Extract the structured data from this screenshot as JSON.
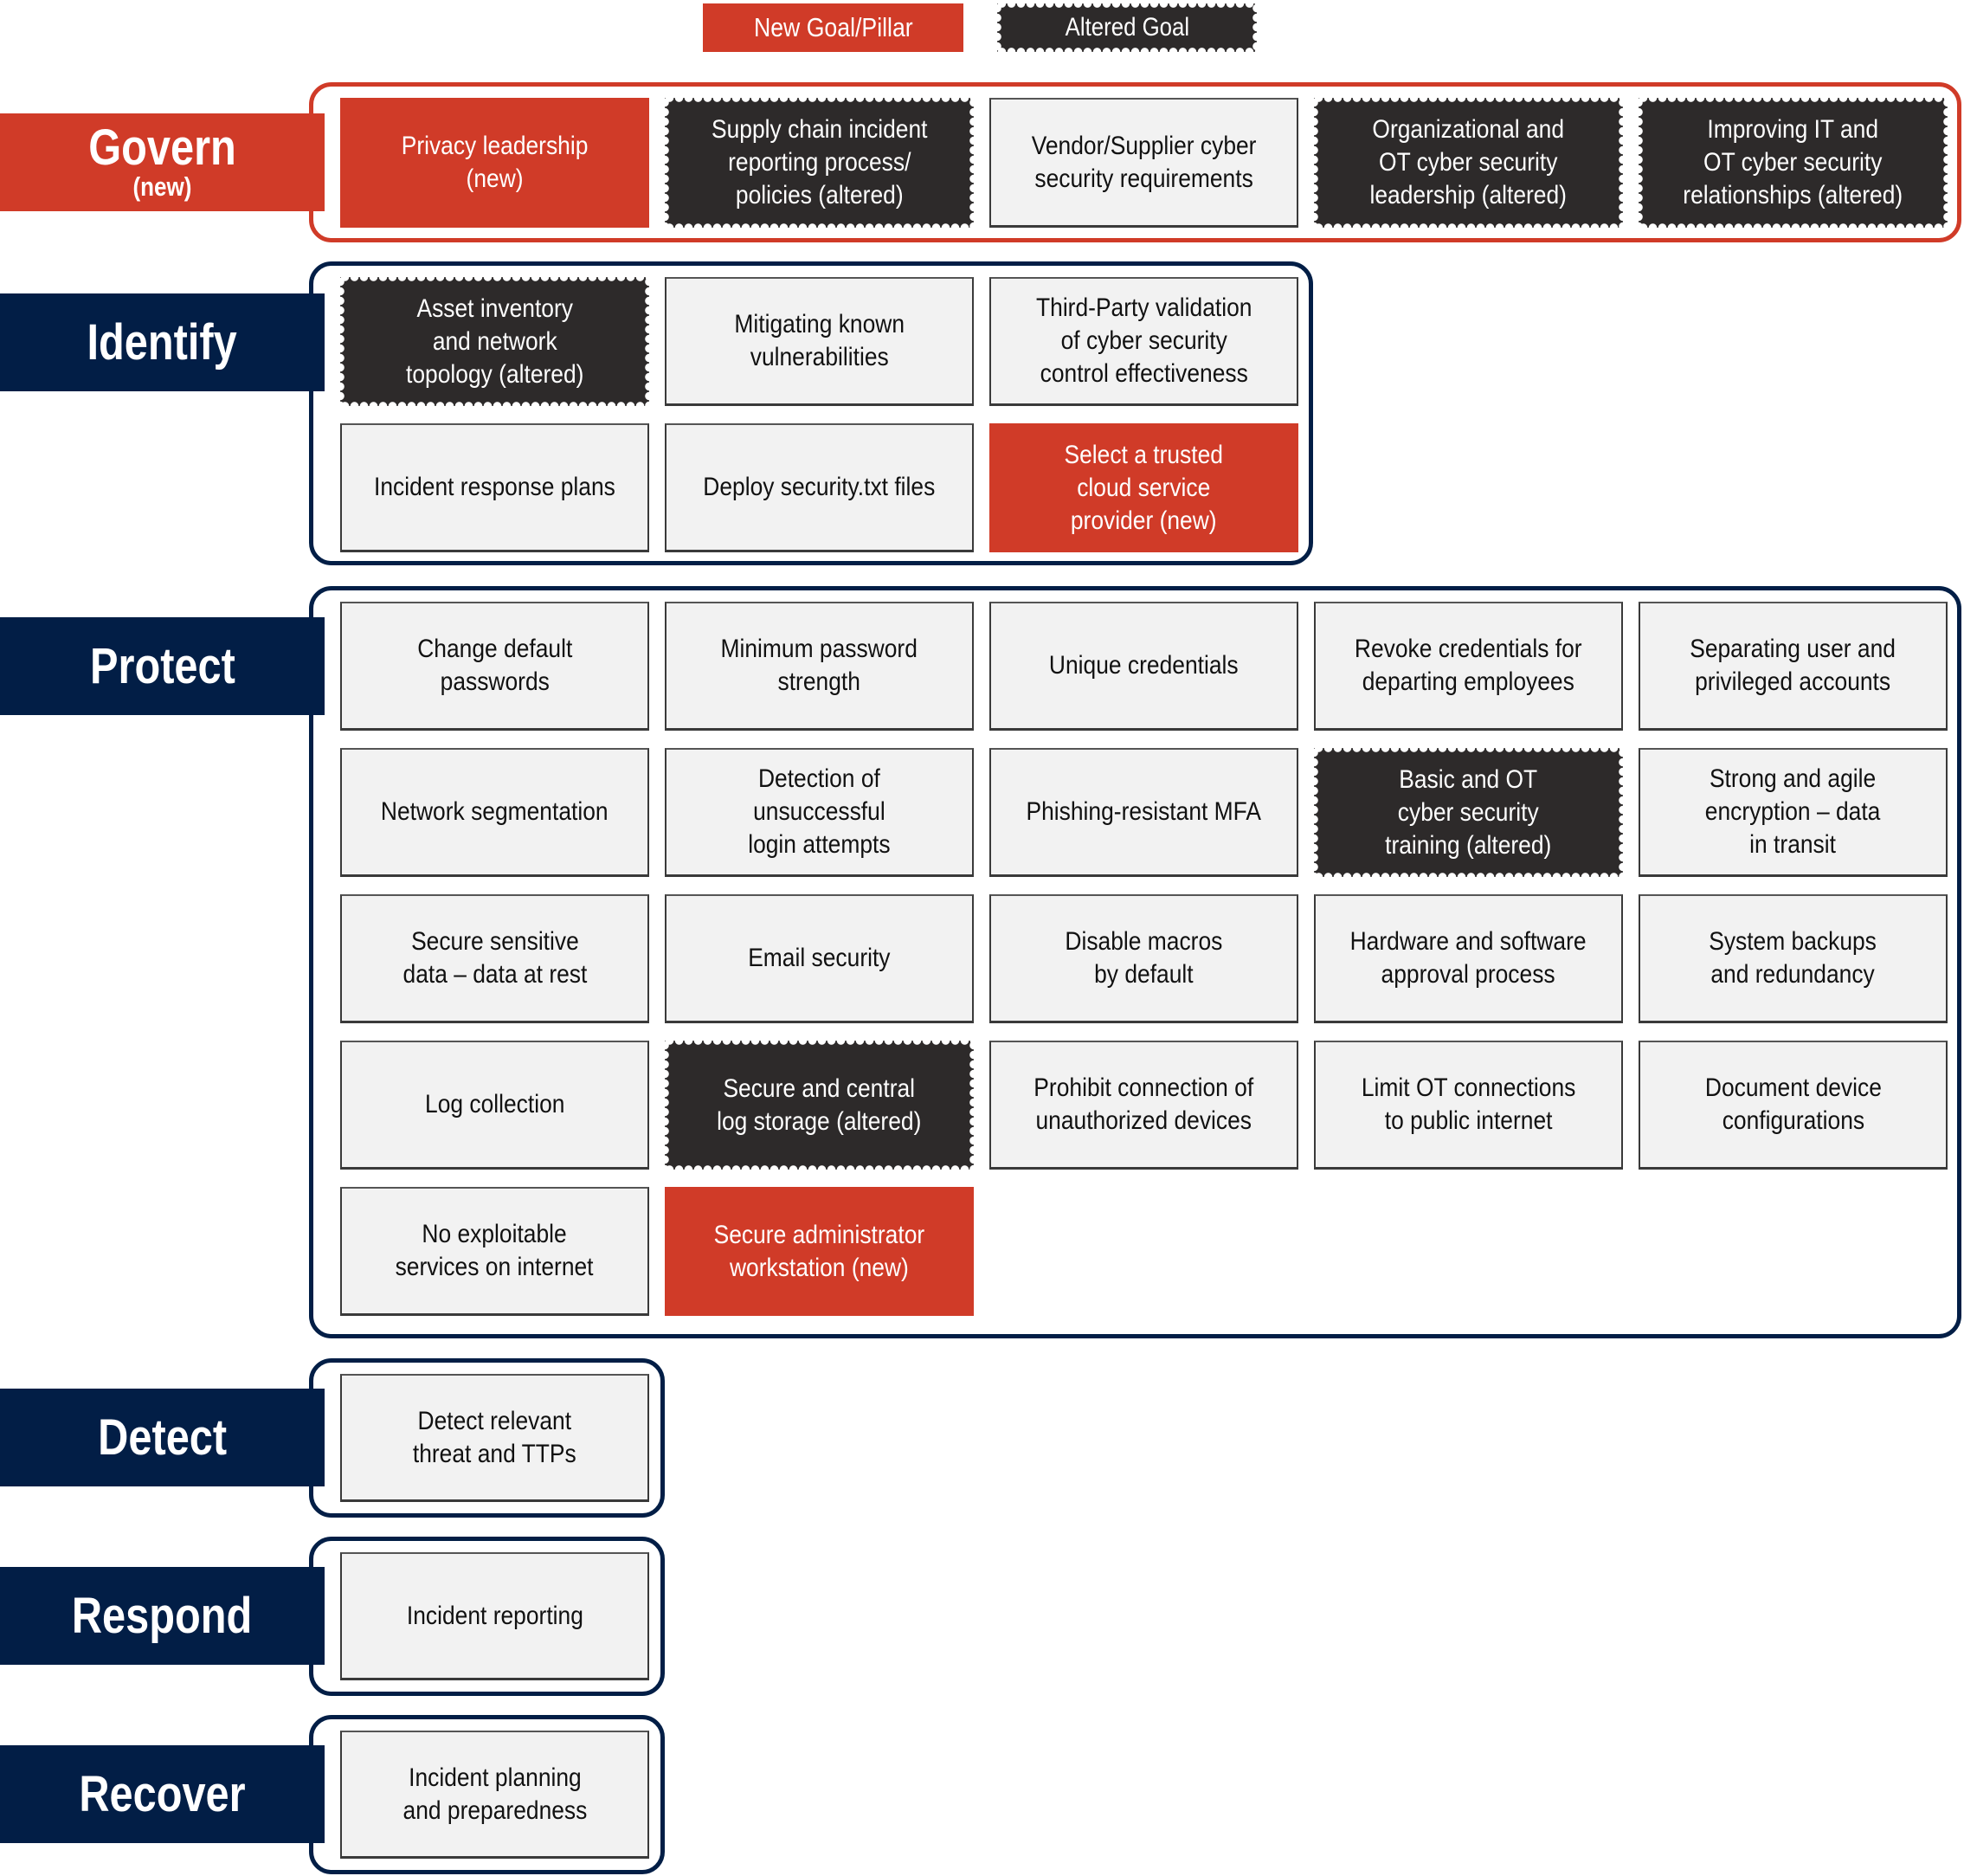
{
  "legend": {
    "new_label": "New Goal/Pillar",
    "altered_label": "Altered Goal"
  },
  "colors": {
    "new": "#d03b28",
    "altered": "#2d2a2a",
    "pillar": "#021e46",
    "standard_box": "#f2f2f2"
  },
  "pillars": {
    "govern": {
      "name": "Govern",
      "tag": "(new)",
      "status": "new",
      "goals": [
        {
          "text": "Privacy leadership\n(new)",
          "status": "new"
        },
        {
          "text": "Supply chain incident\nreporting process/\npolicies (altered)",
          "status": "altered"
        },
        {
          "text": "Vendor/Supplier cyber\nsecurity requirements",
          "status": "standard"
        },
        {
          "text": "Organizational and\nOT cyber security\nleadership (altered)",
          "status": "altered"
        },
        {
          "text": "Improving IT and\nOT cyber security\nrelationships (altered)",
          "status": "altered"
        }
      ]
    },
    "identify": {
      "name": "Identify",
      "goals": [
        {
          "text": "Asset inventory\nand network\ntopology (altered)",
          "status": "altered"
        },
        {
          "text": "Mitigating known\nvulnerabilities",
          "status": "standard"
        },
        {
          "text": "Third-Party validation\nof cyber security\ncontrol effectiveness",
          "status": "standard"
        },
        {
          "text": "Incident response plans",
          "status": "standard"
        },
        {
          "text": "Deploy security.txt files",
          "status": "standard"
        },
        {
          "text": "Select a trusted\ncloud service\nprovider (new)",
          "status": "new"
        }
      ]
    },
    "protect": {
      "name": "Protect",
      "goals": [
        {
          "text": "Change default\npasswords",
          "status": "standard"
        },
        {
          "text": "Minimum password\nstrength",
          "status": "standard"
        },
        {
          "text": "Unique credentials",
          "status": "standard"
        },
        {
          "text": "Revoke credentials for\ndeparting employees",
          "status": "standard"
        },
        {
          "text": "Separating user and\nprivileged accounts",
          "status": "standard"
        },
        {
          "text": "Network segmentation",
          "status": "standard"
        },
        {
          "text": "Detection of\nunsuccessful\nlogin attempts",
          "status": "standard"
        },
        {
          "text": "Phishing-resistant MFA",
          "status": "standard"
        },
        {
          "text": "Basic and OT\ncyber security\ntraining (altered)",
          "status": "altered"
        },
        {
          "text": "Strong and agile\nencryption – data\nin transit",
          "status": "standard"
        },
        {
          "text": "Secure sensitive\ndata – data at rest",
          "status": "standard"
        },
        {
          "text": "Email security",
          "status": "standard"
        },
        {
          "text": "Disable macros\nby default",
          "status": "standard"
        },
        {
          "text": "Hardware and software\napproval process",
          "status": "standard"
        },
        {
          "text": "System backups\nand redundancy",
          "status": "standard"
        },
        {
          "text": "Log collection",
          "status": "standard"
        },
        {
          "text": "Secure and central\nlog storage (altered)",
          "status": "altered"
        },
        {
          "text": "Prohibit connection of\nunauthorized devices",
          "status": "standard"
        },
        {
          "text": "Limit OT connections\nto public internet",
          "status": "standard"
        },
        {
          "text": "Document device\nconfigurations",
          "status": "standard"
        },
        {
          "text": "No exploitable\nservices on internet",
          "status": "standard"
        },
        {
          "text": "Secure administrator\nworkstation (new)",
          "status": "new"
        }
      ]
    },
    "detect": {
      "name": "Detect",
      "goals": [
        {
          "text": "Detect relevant\nthreat and TTPs",
          "status": "standard"
        }
      ]
    },
    "respond": {
      "name": "Respond",
      "goals": [
        {
          "text": "Incident reporting",
          "status": "standard"
        }
      ]
    },
    "recover": {
      "name": "Recover",
      "goals": [
        {
          "text": "Incident planning\nand preparedness",
          "status": "standard"
        }
      ]
    }
  }
}
